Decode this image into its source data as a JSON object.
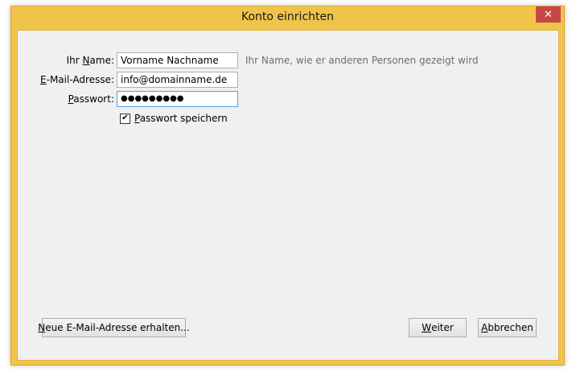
{
  "window": {
    "title": "Konto einrichten",
    "close_glyph": "✕"
  },
  "form": {
    "name": {
      "label_pre": "Ihr ",
      "label_u": "N",
      "label_post": "ame:",
      "value": "Vorname Nachname",
      "hint": "Ihr Name, wie er anderen Personen gezeigt wird"
    },
    "email": {
      "label_pre": "",
      "label_u": "E",
      "label_post": "-Mail-Adresse:",
      "value": "info@domainname.de"
    },
    "password": {
      "label_pre": "",
      "label_u": "P",
      "label_post": "asswort:",
      "value": "●●●●●●●●●"
    },
    "remember": {
      "checked_glyph": "✔",
      "label_u": "P",
      "label_post": "asswort speichern"
    }
  },
  "buttons": {
    "new_address": {
      "label_u": "N",
      "label_post": "eue E-Mail-Adresse erhalten..."
    },
    "next": {
      "label_u": "W",
      "label_post": "eiter"
    },
    "cancel": {
      "label_u": "A",
      "label_post": "bbrechen"
    }
  },
  "colors": {
    "frame": "#f0c44b",
    "close": "#c74747",
    "client_bg": "#f0f0f0",
    "focus": "#569de5"
  }
}
